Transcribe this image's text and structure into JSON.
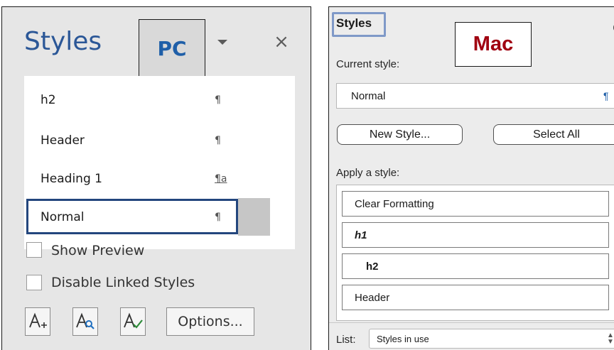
{
  "pc": {
    "title": "Styles",
    "badge": "PC",
    "close_icon": "×",
    "styles": [
      {
        "label": "h2",
        "mark": "¶"
      },
      {
        "label": "Header",
        "mark": "¶"
      },
      {
        "label": "Heading 1",
        "mark": "¶a"
      },
      {
        "label": "Normal",
        "mark": "¶",
        "selected": true
      }
    ],
    "show_preview": "Show Preview",
    "disable_linked": "Disable Linked Styles",
    "options_button": "Options...",
    "icons": [
      "new-style-icon",
      "style-inspector-icon",
      "manage-styles-icon"
    ],
    "accent_color": "#2b5797",
    "selection_color": "#23467d"
  },
  "mac": {
    "title": "Styles",
    "badge": "Mac",
    "current_style_label": "Current style:",
    "current_style_value": "Normal",
    "current_style_mark": "¶",
    "new_style_button": "New Style...",
    "select_all_button": "Select All",
    "apply_label": "Apply a style:",
    "styles": [
      {
        "label": "Clear Formatting",
        "style": "normal"
      },
      {
        "label": "h1",
        "style": "bold-italic"
      },
      {
        "label": "h2",
        "style": "bold-indent"
      },
      {
        "label": "Header",
        "style": "normal"
      }
    ],
    "list_label": "List:",
    "list_value": "Styles in use",
    "badge_color": "#a00010",
    "focus_color": "#7f99c8"
  }
}
